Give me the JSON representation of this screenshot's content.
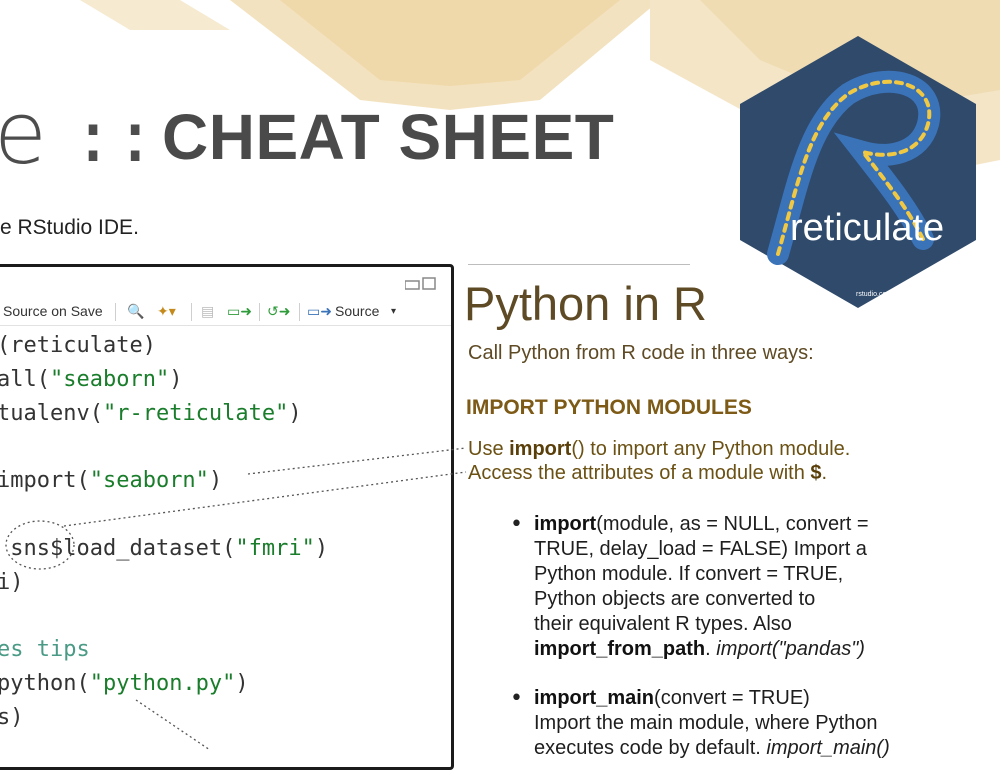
{
  "header": {
    "title_suffix": "e",
    "title_sep": "::",
    "title_main": "CHEAT SHEET",
    "ide_text": "e RStudio IDE."
  },
  "logo": {
    "text": "reticulate",
    "small_text": "rstudio.com",
    "bg_color": "#2f4a6b",
    "letter_color": "#3b73b9"
  },
  "editor": {
    "toolbar": {
      "source_on_save": "Source on Save",
      "source": "Source"
    },
    "lines": [
      {
        "parts": [
          {
            "t": "(reticulate)",
            "c": ""
          }
        ]
      },
      {
        "parts": [
          {
            "t": "all(",
            "c": ""
          },
          {
            "t": "\"seaborn\"",
            "c": "str"
          },
          {
            "t": ")",
            "c": ""
          }
        ]
      },
      {
        "parts": [
          {
            "t": "tualenv(",
            "c": ""
          },
          {
            "t": "\"r-reticulate\"",
            "c": "str"
          },
          {
            "t": ")",
            "c": ""
          }
        ]
      },
      {
        "parts": [
          {
            "t": "",
            "c": ""
          }
        ]
      },
      {
        "parts": [
          {
            "t": "import(",
            "c": ""
          },
          {
            "t": "\"seaborn\"",
            "c": "str"
          },
          {
            "t": ")",
            "c": ""
          }
        ]
      },
      {
        "parts": [
          {
            "t": "",
            "c": ""
          }
        ]
      },
      {
        "parts": [
          {
            "t": " sns$load_dataset(",
            "c": ""
          },
          {
            "t": "\"fmri\"",
            "c": "str"
          },
          {
            "t": ")",
            "c": ""
          }
        ]
      },
      {
        "parts": [
          {
            "t": "i)",
            "c": ""
          }
        ]
      },
      {
        "parts": [
          {
            "t": "",
            "c": ""
          }
        ]
      },
      {
        "parts": [
          {
            "t": "es tips",
            "c": "cmt"
          }
        ]
      },
      {
        "parts": [
          {
            "t": "python(",
            "c": ""
          },
          {
            "t": "\"python.py\"",
            "c": "str"
          },
          {
            "t": ")",
            "c": ""
          }
        ]
      },
      {
        "parts": [
          {
            "t": "s)",
            "c": ""
          }
        ]
      }
    ]
  },
  "content": {
    "section_title": "Python in R",
    "section_subtitle": "Call Python from R code in three ways:",
    "section_heading": "IMPORT PYTHON MODULES",
    "desc1_pre": "Use ",
    "desc1_bold": "import",
    "desc1_post": "() to import any Python module.",
    "desc2_pre": "Access the attributes of a module with ",
    "desc2_bold": "$",
    "desc2_post": ".",
    "bullet1": {
      "bold": "import",
      "text1": "(module, as = NULL, convert =",
      "text2": "TRUE, delay_load = FALSE) Import a",
      "text3": "Python module. If convert = TRUE,",
      "text4": "Python objects are converted to",
      "text5": "their equivalent R types. Also",
      "bold2": "import_from_path",
      "text6": ". ",
      "italic": "import(\"pandas\")"
    },
    "bullet2": {
      "bold": "import_main",
      "text1": "(convert = TRUE)",
      "text2": "Import the main module, where Python",
      "text3": "executes code by default. ",
      "italic": "import_main()"
    }
  },
  "colors": {
    "brown": "#5e4a24",
    "string_green": "#1a7d2b",
    "comment_teal": "#4a9a86",
    "bg_hex": "#f3e2bf"
  }
}
